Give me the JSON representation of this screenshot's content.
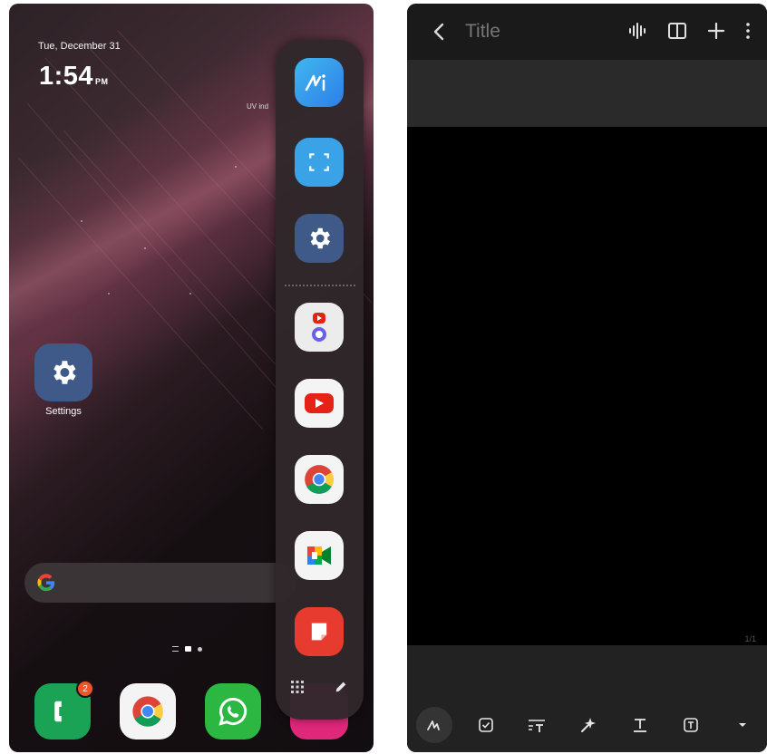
{
  "left_screen": {
    "date": "Tue, December 31",
    "time": "1:54",
    "ampm": "PM",
    "weather_text": "UV ind",
    "home_app": {
      "label": "Settings",
      "icon": "gear-icon",
      "color": "#3f5a88"
    },
    "search_bar": {
      "icon": "google-g-icon"
    },
    "dock": [
      {
        "name": "Phone",
        "icon": "phone-icon",
        "badge": "2"
      },
      {
        "name": "Chrome",
        "icon": "chrome-icon"
      },
      {
        "name": "WhatsApp",
        "icon": "whatsapp-icon"
      }
    ],
    "edge_panel": {
      "apps": [
        "ai-icon",
        "screen-capture-icon",
        "settings-icon",
        "app-pair-icon",
        "youtube-icon",
        "chrome-icon",
        "google-meet-icon",
        "notes-icon"
      ],
      "tools": [
        "apps-grid-icon",
        "edit-pencil-icon"
      ]
    }
  },
  "right_screen": {
    "title": "Title",
    "page_indicator": "1/1",
    "top_tools": [
      "voice-wave-icon",
      "book-view-icon",
      "add-icon",
      "more-icon"
    ],
    "bottom_tools": [
      "pen-icon",
      "checkbox-icon",
      "text-format-icon",
      "ai-assist-icon",
      "text-icon",
      "textbox-icon",
      "expand-icon"
    ]
  }
}
